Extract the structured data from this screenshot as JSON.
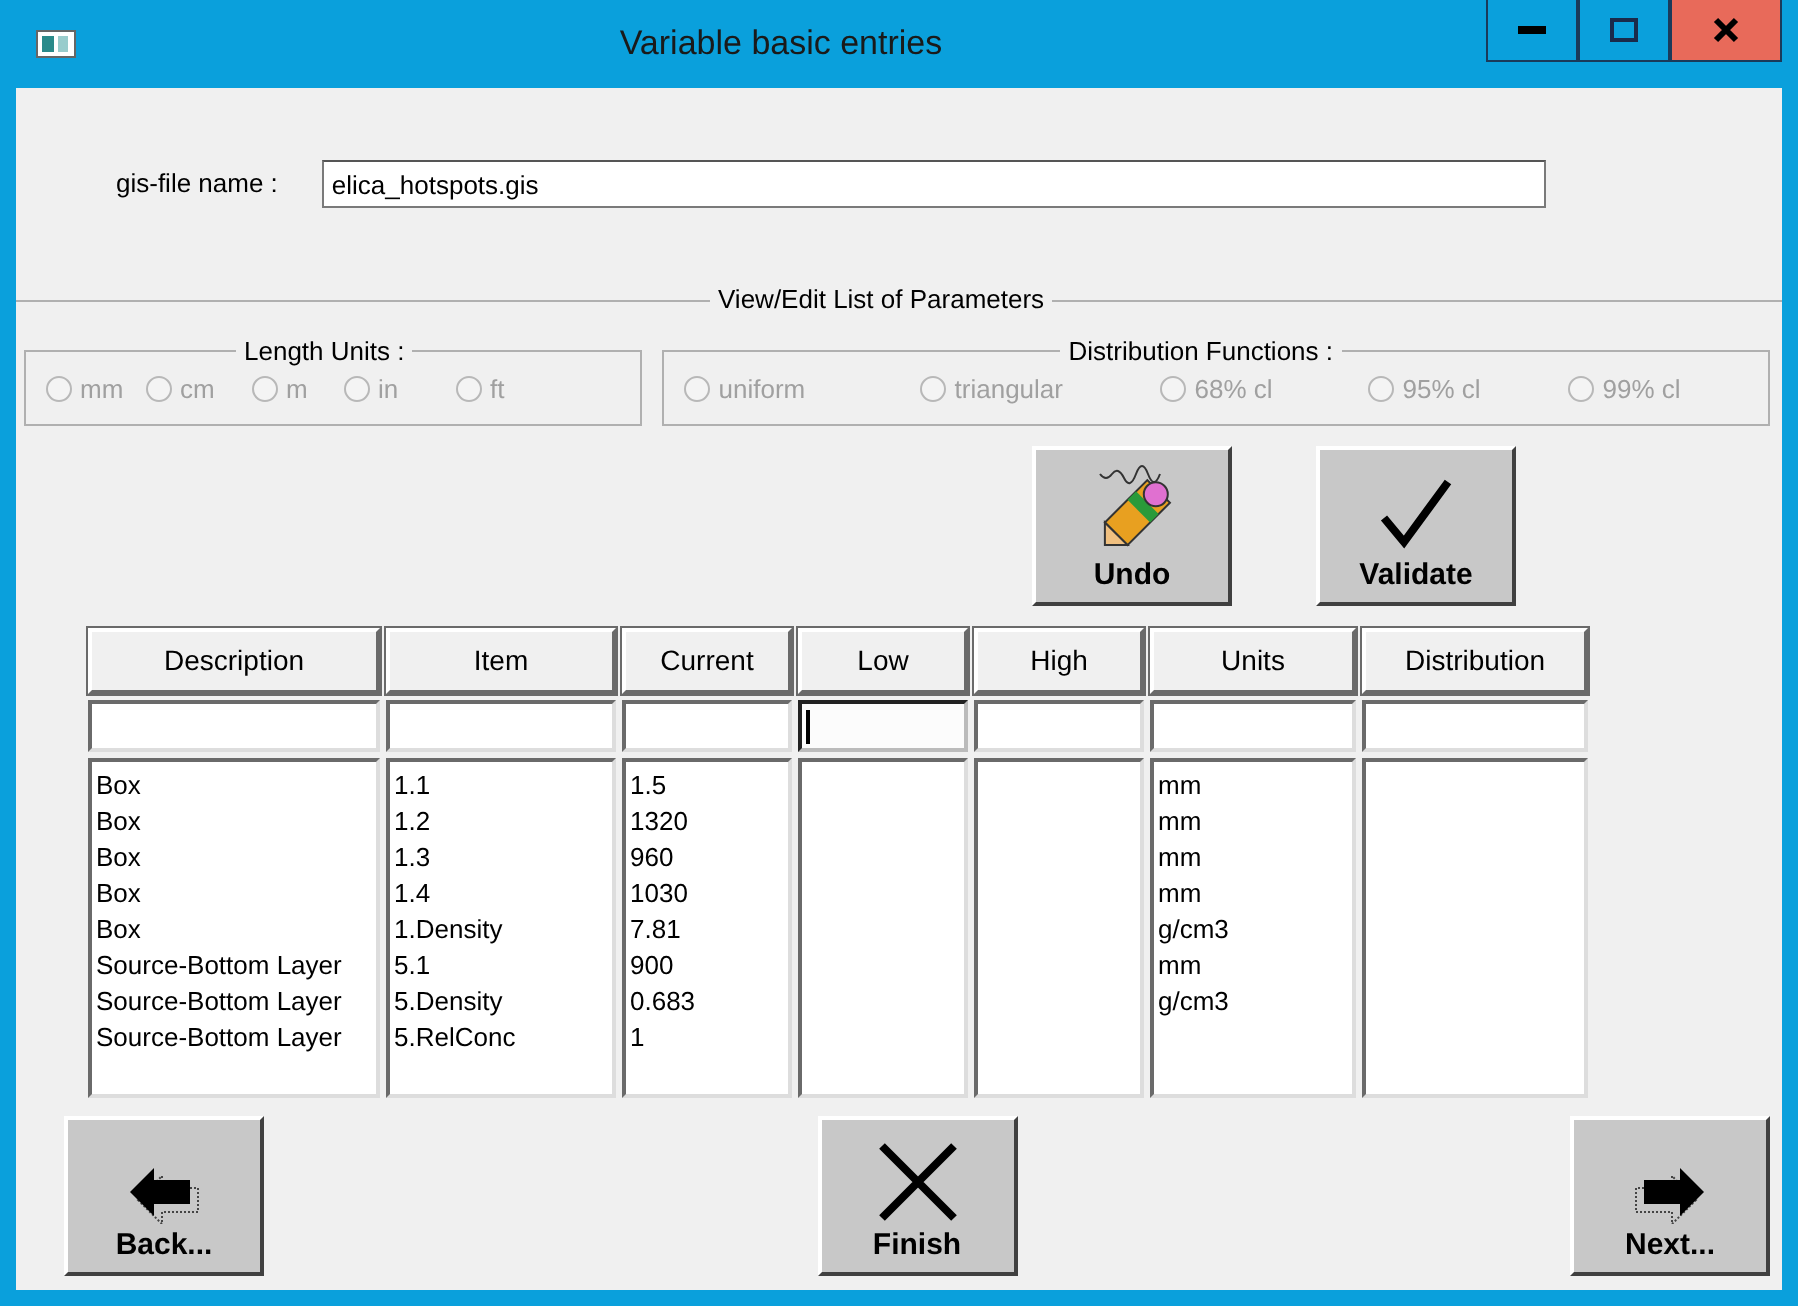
{
  "window": {
    "title": "Variable basic entries"
  },
  "file_name": {
    "label": "gis-file name :",
    "value": "elica_hotspots.gis"
  },
  "parameters_group": {
    "title": "View/Edit List of Parameters"
  },
  "length_units": {
    "title": "Length Units :",
    "options": [
      {
        "label": "mm",
        "checked": false,
        "disabled": true
      },
      {
        "label": "cm",
        "checked": false,
        "disabled": true
      },
      {
        "label": "m",
        "checked": false,
        "disabled": true
      },
      {
        "label": "in",
        "checked": false,
        "disabled": true
      },
      {
        "label": "ft",
        "checked": false,
        "disabled": true
      }
    ]
  },
  "distribution_functions": {
    "title": "Distribution Functions :",
    "options": [
      {
        "label": "uniform",
        "checked": false,
        "disabled": true
      },
      {
        "label": "triangular",
        "checked": false,
        "disabled": true
      },
      {
        "label": "68% cl",
        "checked": false,
        "disabled": true
      },
      {
        "label": "95% cl",
        "checked": false,
        "disabled": true
      },
      {
        "label": "99% cl",
        "checked": false,
        "disabled": true
      }
    ]
  },
  "action_buttons": [
    {
      "kind": "undo",
      "label": "Undo"
    },
    {
      "kind": "validate",
      "label": "Validate"
    }
  ],
  "table": {
    "columns": [
      {
        "header": "Description",
        "focused": false,
        "values": [
          "Box",
          "Box",
          "Box",
          "Box",
          "Box",
          "Source-Bottom Layer",
          "Source-Bottom Layer",
          "Source-Bottom Layer"
        ]
      },
      {
        "header": "Item",
        "focused": false,
        "values": [
          "1.1",
          "1.2",
          "1.3",
          "1.4",
          "1.Density",
          "5.1",
          "5.Density",
          "5.RelConc"
        ]
      },
      {
        "header": "Current",
        "focused": false,
        "values": [
          "1.5",
          "1320",
          "960",
          "1030",
          "7.81",
          "900",
          "0.683",
          "1"
        ]
      },
      {
        "header": "Low",
        "focused": true
      },
      {
        "header": "High",
        "focused": false
      },
      {
        "header": "Units",
        "focused": false,
        "values": [
          "mm",
          "mm",
          "mm",
          "mm",
          "g/cm3",
          "mm",
          "g/cm3"
        ]
      },
      {
        "header": "Distribution",
        "focused": false
      }
    ]
  },
  "nav_buttons": [
    {
      "kind": "back",
      "label": "Back..."
    },
    {
      "kind": "finish",
      "label": "Finish"
    },
    {
      "kind": "next",
      "label": "Next..."
    }
  ]
}
